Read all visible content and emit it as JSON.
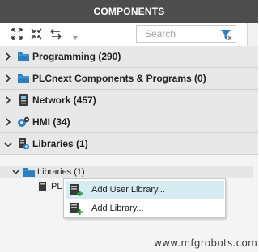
{
  "window": {
    "title": "COMPONENTS"
  },
  "toolbar": {
    "icons": [
      "expand-all-icon",
      "collapse-all-icon",
      "swap-icon"
    ],
    "search": {
      "placeholder": "Search",
      "value": ""
    }
  },
  "categories": [
    {
      "label": "Programming (290)",
      "icon": "folder-icon",
      "expanded": false
    },
    {
      "label": "PLCnext Components & Programs (0)",
      "icon": "folder-icon",
      "expanded": false
    },
    {
      "label": "Network (457)",
      "icon": "network-icon",
      "expanded": false
    },
    {
      "label": "HMI (34)",
      "icon": "hmi-icon",
      "expanded": false
    },
    {
      "label": "Libraries (1)",
      "icon": "libraries-icon",
      "expanded": true
    }
  ],
  "libraries_tree": {
    "folder": {
      "label": "Libraries (1)",
      "expanded": true
    },
    "item": {
      "label": "PL"
    }
  },
  "context_menu": {
    "items": [
      {
        "label": "Add User Library...",
        "icon": "add-library-icon",
        "highlighted": true
      },
      {
        "label": "Add Library...",
        "icon": "add-library-icon",
        "highlighted": false
      }
    ]
  },
  "watermark": "www.mfgrobots.com",
  "colors": {
    "titlebar": "#4d4d4d",
    "folder": "#2c7fc0",
    "add_green": "#2e9a44",
    "highlight": "#d6ecf3"
  }
}
